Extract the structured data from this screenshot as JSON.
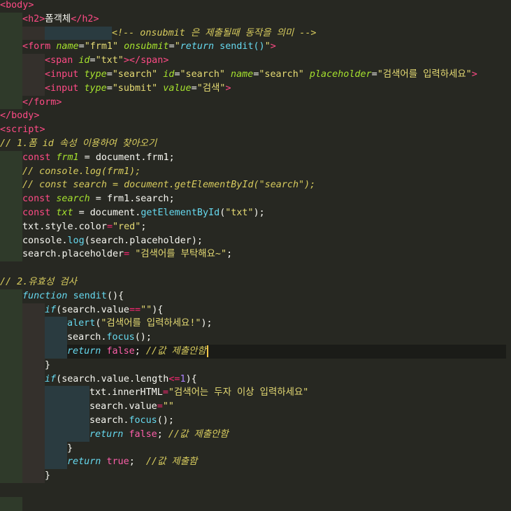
{
  "lines": [
    {
      "indent": 0,
      "segments": [
        [
          "<",
          "tag"
        ],
        [
          "body",
          "tag"
        ],
        [
          ">",
          "tag"
        ]
      ]
    },
    {
      "indent": 1,
      "segments": [
        [
          "<",
          "tag"
        ],
        [
          "h2",
          "tag"
        ],
        [
          ">",
          "tag"
        ],
        [
          "폼객체",
          "txt"
        ],
        [
          "</",
          "tag"
        ],
        [
          "h2",
          "tag"
        ],
        [
          ">",
          "tag"
        ]
      ]
    },
    {
      "indent": 5,
      "segments": [
        [
          "<!-- onsubmit 은 제출될때 동작을 의미 -->",
          "com"
        ]
      ]
    },
    {
      "indent": 1,
      "segments": [
        [
          "<",
          "tag"
        ],
        [
          "form ",
          "tag"
        ],
        [
          "name",
          "attr"
        ],
        [
          "=",
          "txt"
        ],
        [
          "\"frm1\"",
          "str"
        ],
        [
          " onsubmit",
          "attr"
        ],
        [
          "=",
          "txt"
        ],
        [
          "\"",
          "str"
        ],
        [
          "return",
          "kw"
        ],
        [
          " sendit()",
          "fn"
        ],
        [
          "\"",
          "str"
        ],
        [
          ">",
          "tag"
        ]
      ]
    },
    {
      "indent": 2,
      "segments": [
        [
          "<",
          "tag"
        ],
        [
          "span ",
          "tag"
        ],
        [
          "id",
          "attr"
        ],
        [
          "=",
          "txt"
        ],
        [
          "\"txt\"",
          "str"
        ],
        [
          "></",
          "tag"
        ],
        [
          "span",
          "tag"
        ],
        [
          ">",
          "tag"
        ]
      ]
    },
    {
      "indent": 2,
      "segments": [
        [
          "<",
          "tag"
        ],
        [
          "input ",
          "tag"
        ],
        [
          "type",
          "attr"
        ],
        [
          "=",
          "txt"
        ],
        [
          "\"search\"",
          "str"
        ],
        [
          " id",
          "attr"
        ],
        [
          "=",
          "txt"
        ],
        [
          "\"search\"",
          "str"
        ],
        [
          " name",
          "attr"
        ],
        [
          "=",
          "txt"
        ],
        [
          "\"search\"",
          "str"
        ],
        [
          " placeholder",
          "attr"
        ],
        [
          "=",
          "txt"
        ],
        [
          "\"검색어를 입력하세요\"",
          "str"
        ],
        [
          ">",
          "tag"
        ]
      ]
    },
    {
      "indent": 2,
      "segments": [
        [
          "<",
          "tag"
        ],
        [
          "input ",
          "tag"
        ],
        [
          "type",
          "attr"
        ],
        [
          "=",
          "txt"
        ],
        [
          "\"submit\"",
          "str"
        ],
        [
          " value",
          "attr"
        ],
        [
          "=",
          "txt"
        ],
        [
          "\"검색\"",
          "str"
        ],
        [
          ">",
          "tag"
        ]
      ]
    },
    {
      "indent": 1,
      "segments": [
        [
          "</",
          "tag"
        ],
        [
          "form",
          "tag"
        ],
        [
          ">",
          "tag"
        ]
      ]
    },
    {
      "indent": 0,
      "segments": [
        [
          "</",
          "tag"
        ],
        [
          "body",
          "tag"
        ],
        [
          ">",
          "tag"
        ]
      ]
    },
    {
      "indent": 0,
      "segments": [
        [
          "<",
          "tag"
        ],
        [
          "script",
          "tag"
        ],
        [
          ">",
          "tag"
        ]
      ]
    },
    {
      "indent": 0,
      "segments": [
        [
          "// 1.폼 id 속성 이용하여 찾아오기",
          "com"
        ]
      ]
    },
    {
      "indent": 1,
      "segments": [
        [
          "const ",
          "kw2"
        ],
        [
          "frm1",
          "attr"
        ],
        [
          " = ",
          "txt"
        ],
        [
          "document",
          "txt"
        ],
        [
          ".",
          "txt"
        ],
        [
          "frm1",
          "txt"
        ],
        [
          ";",
          "txt"
        ]
      ]
    },
    {
      "indent": 1,
      "segments": [
        [
          "// console.log(frm1);",
          "com"
        ]
      ]
    },
    {
      "indent": 1,
      "segments": [
        [
          "// const search = document.getElementById(\"search\");",
          "com"
        ]
      ]
    },
    {
      "indent": 1,
      "segments": [
        [
          "const ",
          "kw2"
        ],
        [
          "search",
          "attr"
        ],
        [
          " = ",
          "txt"
        ],
        [
          "frm1",
          "txt"
        ],
        [
          ".",
          "txt"
        ],
        [
          "search",
          "txt"
        ],
        [
          ";",
          "txt"
        ]
      ]
    },
    {
      "indent": 1,
      "segments": [
        [
          "const ",
          "kw2"
        ],
        [
          "txt",
          "attr"
        ],
        [
          " = ",
          "txt"
        ],
        [
          "document",
          "txt"
        ],
        [
          ".",
          "txt"
        ],
        [
          "getElementById",
          "fn"
        ],
        [
          "(",
          "txt"
        ],
        [
          "\"txt\"",
          "str"
        ],
        [
          ");",
          "txt"
        ]
      ]
    },
    {
      "indent": 1,
      "segments": [
        [
          "txt",
          "txt"
        ],
        [
          ".",
          "txt"
        ],
        [
          "style",
          "txt"
        ],
        [
          ".",
          "txt"
        ],
        [
          "color",
          "txt"
        ],
        [
          "=",
          "op"
        ],
        [
          "\"red\"",
          "str"
        ],
        [
          ";",
          "txt"
        ]
      ]
    },
    {
      "indent": 1,
      "segments": [
        [
          "console",
          "txt"
        ],
        [
          ".",
          "txt"
        ],
        [
          "log",
          "fn"
        ],
        [
          "(",
          "txt"
        ],
        [
          "search",
          "txt"
        ],
        [
          ".",
          "txt"
        ],
        [
          "placeholder",
          "txt"
        ],
        [
          ");",
          "txt"
        ]
      ]
    },
    {
      "indent": 1,
      "segments": [
        [
          "search",
          "txt"
        ],
        [
          ".",
          "txt"
        ],
        [
          "placeholder",
          "txt"
        ],
        [
          "= ",
          "op"
        ],
        [
          "\"검색어를 부탁해요~\"",
          "str"
        ],
        [
          ";",
          "txt"
        ]
      ]
    },
    {
      "indent": 0,
      "segments": []
    },
    {
      "indent": 0,
      "segments": [
        [
          "// 2.유효성 검사",
          "com"
        ]
      ]
    },
    {
      "indent": 1,
      "segments": [
        [
          "function ",
          "kw"
        ],
        [
          "sendit",
          "fn"
        ],
        [
          "(){",
          "txt"
        ]
      ]
    },
    {
      "indent": 2,
      "segments": [
        [
          "if",
          "kw"
        ],
        [
          "(",
          "txt"
        ],
        [
          "search",
          "txt"
        ],
        [
          ".",
          "txt"
        ],
        [
          "value",
          "txt"
        ],
        [
          "==",
          "op"
        ],
        [
          "\"\"",
          "str"
        ],
        [
          "){",
          "txt"
        ]
      ]
    },
    {
      "indent": 3,
      "segments": [
        [
          "alert",
          "fn"
        ],
        [
          "(",
          "txt"
        ],
        [
          "\"검색어를 입력하세요!\"",
          "str"
        ],
        [
          ");",
          "txt"
        ]
      ]
    },
    {
      "indent": 3,
      "segments": [
        [
          "search",
          "txt"
        ],
        [
          ".",
          "txt"
        ],
        [
          "focus",
          "fn"
        ],
        [
          "();",
          "txt"
        ]
      ]
    },
    {
      "indent": 3,
      "current": true,
      "segments": [
        [
          "return ",
          "kw"
        ],
        [
          "false",
          "bool"
        ],
        [
          "; ",
          "txt"
        ],
        [
          "//값 제출안함",
          "com"
        ]
      ]
    },
    {
      "indent": 2,
      "segments": [
        [
          "}",
          "txt"
        ]
      ]
    },
    {
      "indent": 2,
      "segments": [
        [
          "if",
          "kw"
        ],
        [
          "(",
          "txt"
        ],
        [
          "search",
          "txt"
        ],
        [
          ".",
          "txt"
        ],
        [
          "value",
          "txt"
        ],
        [
          ".",
          "txt"
        ],
        [
          "length",
          "txt"
        ],
        [
          "<=",
          "op"
        ],
        [
          "1",
          "num"
        ],
        [
          "){",
          "txt"
        ]
      ]
    },
    {
      "indent": 4,
      "segments": [
        [
          "txt",
          "txt"
        ],
        [
          ".",
          "txt"
        ],
        [
          "innerHTML",
          "txt"
        ],
        [
          "=",
          "op"
        ],
        [
          "\"검색어는 두자 이상 입력하세요\"",
          "str"
        ]
      ]
    },
    {
      "indent": 4,
      "segments": [
        [
          "search",
          "txt"
        ],
        [
          ".",
          "txt"
        ],
        [
          "value",
          "txt"
        ],
        [
          "=",
          "op"
        ],
        [
          "\"\"",
          "str"
        ]
      ]
    },
    {
      "indent": 4,
      "segments": [
        [
          "search",
          "txt"
        ],
        [
          ".",
          "txt"
        ],
        [
          "focus",
          "fn"
        ],
        [
          "();",
          "txt"
        ]
      ]
    },
    {
      "indent": 4,
      "segments": [
        [
          "return ",
          "kw"
        ],
        [
          "false",
          "bool"
        ],
        [
          "; ",
          "txt"
        ],
        [
          "//값 제출안함",
          "com"
        ]
      ]
    },
    {
      "indent": 3,
      "segments": [
        [
          "}",
          "txt"
        ]
      ]
    },
    {
      "indent": 3,
      "segments": [
        [
          "return ",
          "kw"
        ],
        [
          "true",
          "bool"
        ],
        [
          ";  ",
          "txt"
        ],
        [
          "//값 제출함",
          "com"
        ]
      ]
    },
    {
      "indent": 2,
      "segments": [
        [
          "}",
          "txt"
        ]
      ]
    },
    {
      "indent": 0,
      "segments": []
    },
    {
      "indent": 1,
      "segments": []
    }
  ]
}
